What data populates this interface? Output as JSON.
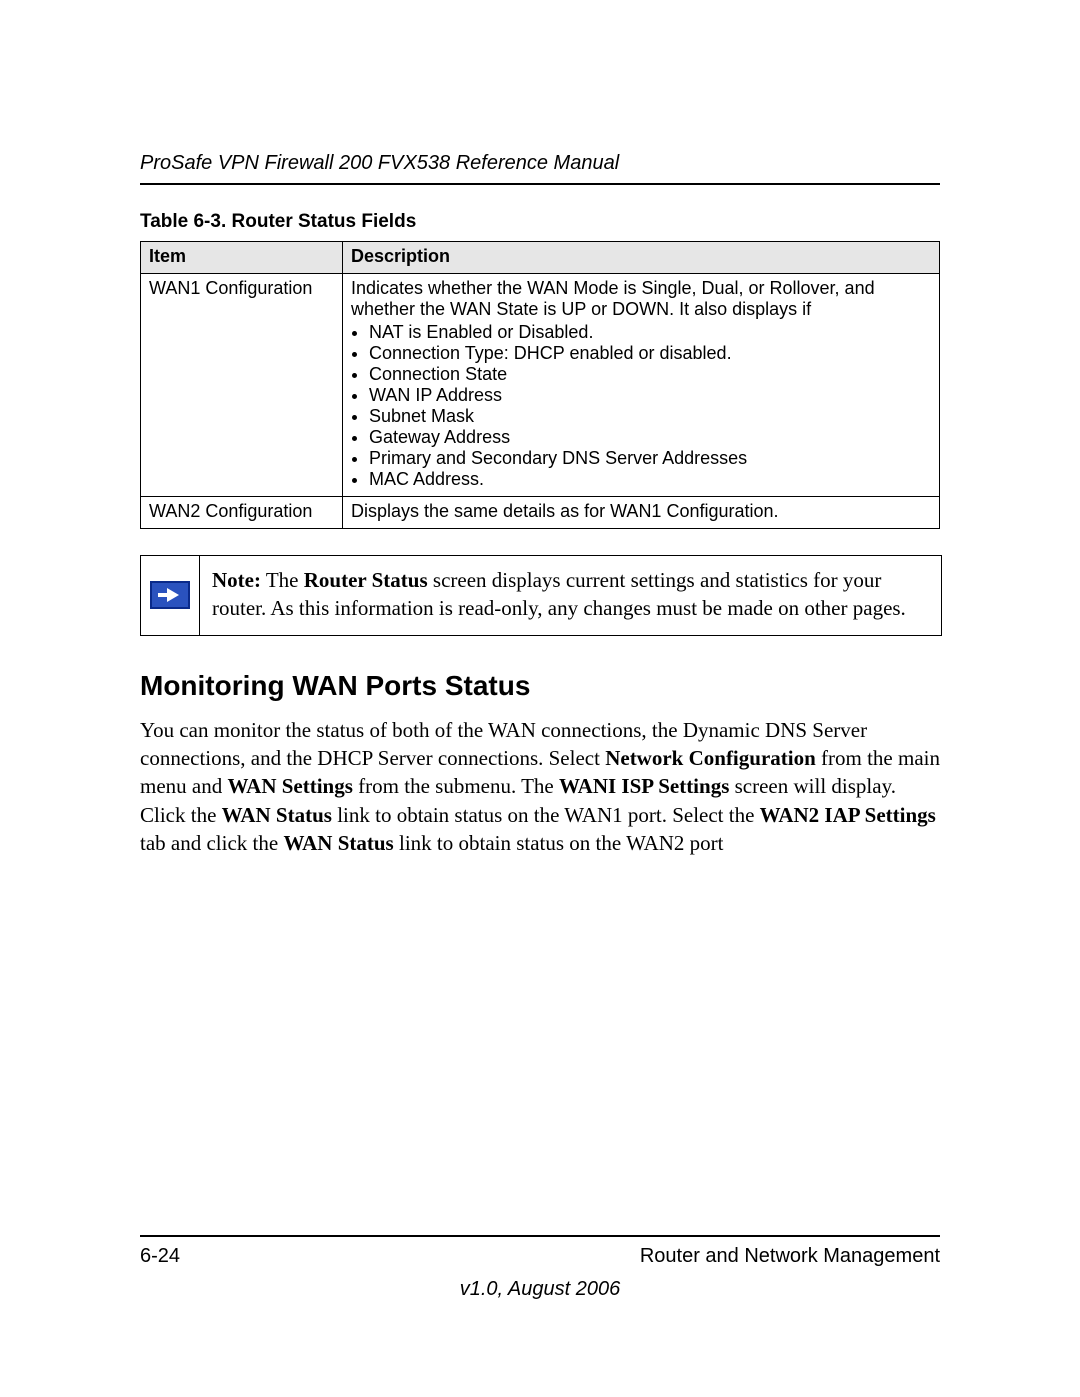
{
  "header": {
    "doc_title": "ProSafe VPN Firewall 200 FVX538 Reference Manual"
  },
  "table": {
    "caption": "Table 6-3.  Router Status Fields",
    "headers": {
      "item": "Item",
      "description": "Description"
    },
    "rows": [
      {
        "item": "WAN1 Configuration",
        "desc_lead": "Indicates whether the WAN Mode is Single, Dual, or Rollover, and whether the WAN State is UP or DOWN. It also displays if",
        "bullets": [
          "NAT is Enabled or Disabled.",
          "Connection Type: DHCP enabled or disabled.",
          "Connection State",
          "WAN IP Address",
          "Subnet Mask",
          "Gateway Address",
          "Primary and Secondary DNS Server Addresses",
          "MAC Address."
        ]
      },
      {
        "item": "WAN2 Configuration",
        "desc_lead": "Displays the same details as for WAN1 Configuration.",
        "bullets": []
      }
    ]
  },
  "note": {
    "lead": "Note:",
    "bold_subject": "Router Status",
    "before_subject": " The ",
    "after_subject": " screen displays current settings and statistics for your router. As this information is read-only, any changes must be made on other pages."
  },
  "section": {
    "heading": "Monitoring WAN Ports Status",
    "para_parts": [
      {
        "t": "You can monitor the status of both of the WAN connections, the Dynamic DNS Server connections, and the DHCP Server connections. Select ",
        "b": false
      },
      {
        "t": "Network Configuration",
        "b": true
      },
      {
        "t": " from the main menu and ",
        "b": false
      },
      {
        "t": "WAN Settings",
        "b": true
      },
      {
        "t": " from the submenu. The ",
        "b": false
      },
      {
        "t": "WANI ISP Settings",
        "b": true
      },
      {
        "t": " screen will display. Click the ",
        "b": false
      },
      {
        "t": "WAN Status",
        "b": true
      },
      {
        "t": " link to obtain status on the WAN1 port. Select the ",
        "b": false
      },
      {
        "t": "WAN2 IAP Settings",
        "b": true
      },
      {
        "t": " tab and click the ",
        "b": false
      },
      {
        "t": "WAN Status",
        "b": true
      },
      {
        "t": " link to obtain status on the WAN2 port",
        "b": false
      }
    ]
  },
  "footer": {
    "page_num": "6-24",
    "chapter": "Router and Network Management",
    "version": "v1.0, August 2006"
  }
}
